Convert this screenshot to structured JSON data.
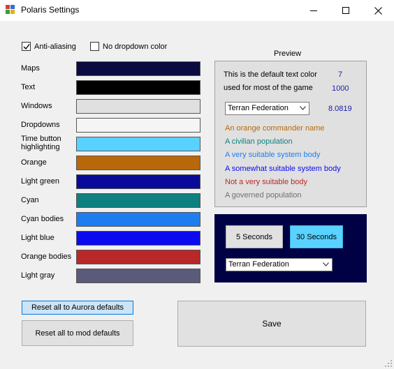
{
  "window": {
    "title": "Polaris Settings",
    "controls": [
      "minimize-icon",
      "maximize-icon",
      "close-icon"
    ]
  },
  "options": {
    "anti_aliasing": {
      "label": "Anti-aliasing",
      "checked": true
    },
    "no_dropdown_color": {
      "label": "No dropdown color",
      "checked": false
    }
  },
  "colors": [
    {
      "label": "Maps",
      "color": "#0a0a40"
    },
    {
      "label": "Text",
      "color": "#000000"
    },
    {
      "label": "Windows",
      "color": "#e0e0e0"
    },
    {
      "label": "Dropdowns",
      "color": "#f5f5f5"
    },
    {
      "label": "Time button highlighting",
      "color": "#5ad2ff"
    },
    {
      "label": "Orange",
      "color": "#b8680a"
    },
    {
      "label": "Light green",
      "color": "#0a0a9a"
    },
    {
      "label": "Cyan",
      "color": "#0f8080"
    },
    {
      "label": "Cyan bodies",
      "color": "#1e7ef0"
    },
    {
      "label": "Light blue",
      "color": "#0a0af0"
    },
    {
      "label": "Orange bodies",
      "color": "#b82828"
    },
    {
      "label": "Light gray",
      "color": "#5a5a7a"
    }
  ],
  "preview": {
    "title": "Preview",
    "default_text_line1": "This is the default text color",
    "default_text_line2": "used for most of the game",
    "num1": "7",
    "num2": "1000",
    "combo_value": "Terran Federation",
    "num3": "8.0819",
    "lines": [
      {
        "text": "An orange commander name",
        "color": "#b8680a"
      },
      {
        "text": "A civilian population",
        "color": "#0f8080"
      },
      {
        "text": "A very suitable system body",
        "color": "#1e7ef0"
      },
      {
        "text": "A somewhat suitable system body",
        "color": "#0a0af0"
      },
      {
        "text": "Not a very suitable body",
        "color": "#b82828"
      },
      {
        "text": "A governed population",
        "color": "#707070"
      }
    ]
  },
  "timer": {
    "btn_5s": "5 Seconds",
    "btn_30s": "30 Seconds",
    "combo_value": "Terran Federation"
  },
  "buttons": {
    "reset_aurora": "Reset all to Aurora defaults",
    "reset_mod": "Reset all to mod defaults",
    "save": "Save"
  }
}
